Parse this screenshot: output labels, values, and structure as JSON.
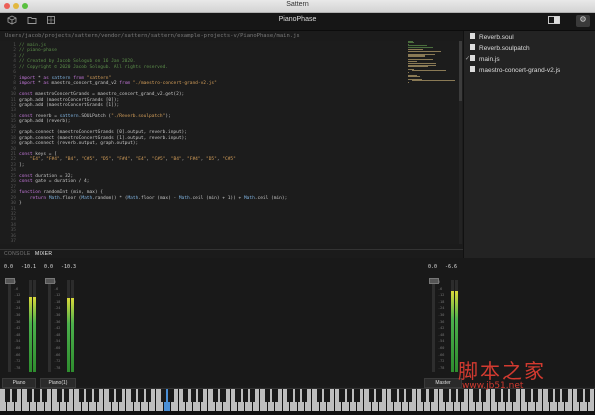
{
  "window": {
    "title": "Sattern"
  },
  "toolbar": {
    "project_title": "PianoPhase",
    "icons": [
      "cube-icon",
      "folder-icon",
      "grid-icon",
      "view-toggle-icon",
      "gear-icon"
    ]
  },
  "editor": {
    "path": "Users/jacob/projects/sattern/vendor/sattern/sattern/example-projects-v/PianoPhase/main.js",
    "lines": [
      "// main.js",
      "// piano-phase",
      "//",
      "// Created by Jacob Sologub on 16 Jan 2020.",
      "// Copyright © 2020 Jacob Sologub. All rights reserved.",
      "",
      "import * as sattern from \"sattern\"",
      "import * as maestro_concert_grand_v2 from \"./maestro-concert-grand-v2.js\"",
      "",
      "const maestroConcertGrands = maestro_concert_grand_v2.get(2);",
      "graph.add (maestroConcertGrands [0]);",
      "graph.add (maestroConcertGrands [1]);",
      "",
      "const reverb = sattern.SOULPatch (\"./Reverb.soulpatch\");",
      "graph.add (reverb);",
      "",
      "graph.connect (maestroConcertGrands [0].output, reverb.input);",
      "graph.connect (maestroConcertGrands [1].output, reverb.input);",
      "graph.connect (reverb.output, graph.output);",
      "",
      "const keys = [",
      "    \"E4\", \"F#4\", \"B4\", \"C#5\", \"D5\", \"F#4\", \"E4\", \"C#5\", \"B4\", \"F#4\", \"D5\", \"C#5\"",
      "];",
      "",
      "const duration = 32;",
      "const gate = duration / 4;",
      "",
      "function randomInt (min, max) {",
      "    return Math.floor (Math.random() * (Math.floor (max) - Math.ceil (min) + 1)) + Math.ceil (min);",
      "}"
    ],
    "line_numbers": [
      "1",
      "2",
      "3",
      "4",
      "5",
      "6",
      "7",
      "8",
      "9",
      "10",
      "11",
      "12",
      "13",
      "14",
      "15",
      "16",
      "17",
      "18",
      "19",
      "20",
      "21",
      "22",
      "23",
      "24",
      "25",
      "26",
      "27",
      "28",
      "29",
      "30",
      "31",
      "32",
      "33",
      "34",
      "35",
      "36",
      "37",
      "38",
      "39",
      "40"
    ]
  },
  "sidebar": {
    "files": [
      {
        "name": "Reverb.soul",
        "selected": false
      },
      {
        "name": "Reverb.soulpatch",
        "selected": false
      },
      {
        "name": "main.js",
        "selected": true
      },
      {
        "name": "maestro-concert-grand-v2.js",
        "selected": false
      }
    ]
  },
  "panel": {
    "tabs": [
      {
        "label": "CONSOLE",
        "active": false
      },
      {
        "label": "MIXER",
        "active": true
      }
    ]
  },
  "mixer": {
    "strips": [
      {
        "name": "Piano",
        "values": [
          "0.0",
          "-10.1"
        ],
        "level": 0.82
      },
      {
        "name": "Piano(1)",
        "values": [
          "0.0",
          "-10.3"
        ],
        "level": 0.8
      },
      {
        "name": "Master",
        "values": [
          "0.0",
          "-6.6"
        ],
        "level": 0.88
      }
    ],
    "scale": [
      "0",
      "-6",
      "-12",
      "-18",
      "-24",
      "-30",
      "-36",
      "-42",
      "-48",
      "-54",
      "-60",
      "-66",
      "-72",
      "-78"
    ]
  },
  "keyboard": {
    "highlighted_key_index": 22
  },
  "watermark": {
    "text": "脚本之家",
    "url": "www.jb51.net"
  },
  "colors": {
    "accent": "#4a8fd6",
    "meter_green": "#4cb04c",
    "meter_yellow": "#d9d93a",
    "watermark_red": "#d23a30"
  }
}
